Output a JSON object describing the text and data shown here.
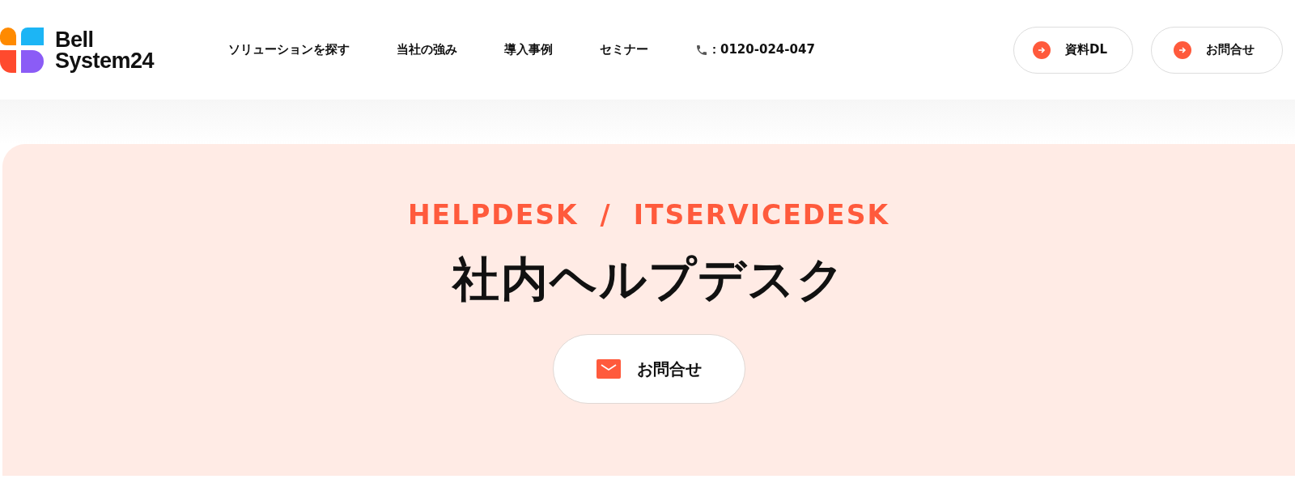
{
  "header": {
    "logo_lines": [
      "Bell",
      "System24"
    ],
    "nav": [
      {
        "label": "ソリューションを探す"
      },
      {
        "label": "当社の強み"
      },
      {
        "label": "導入事例"
      },
      {
        "label": "セミナー"
      }
    ],
    "phone": "：0120-024-047",
    "buttons": [
      {
        "label": "資料DL"
      },
      {
        "label": "お問合せ"
      }
    ]
  },
  "hero": {
    "subtitle": "HELPDESK  /  ITSERVICEDESK",
    "title": "社内ヘルプデスク",
    "button": "お問合せ"
  }
}
